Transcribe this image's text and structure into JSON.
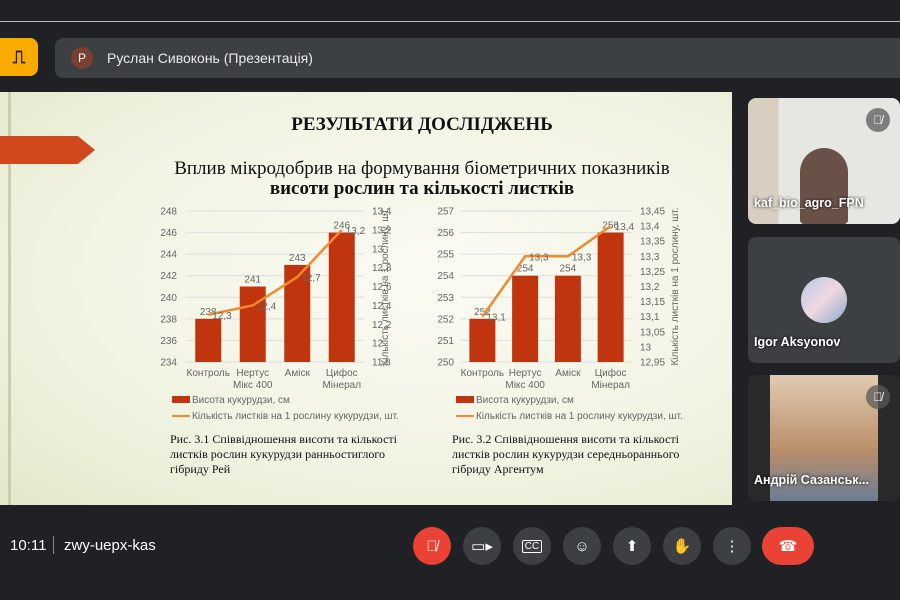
{
  "meeting": {
    "time": "10:11",
    "code": "zwy-uepx-kas"
  },
  "presenter": {
    "avatar_letter": "Р",
    "label": "Руслан Сивоконь (Презентація)"
  },
  "slide": {
    "title": "РЕЗУЛЬТАТИ ДОСЛІДЖЕНЬ",
    "subtitle_line1": "Вплив мікродобрив на формування біометричних показників",
    "subtitle_line2": "висоти рослин та кількості листків",
    "captions": [
      "Рис. 3.1 Співвідношення висоти та кількості листків рослин кукурудзи ранньостиглого гібриду Рей",
      "Рис. 3.2 Співвідношення висоти та кількості листків рослин кукурудзи середньораннього гібриду Аргентум"
    ]
  },
  "chart_data": [
    {
      "type": "bar+line",
      "categories": [
        "Контроль",
        "Нертус Мікс 400",
        "Аміск",
        "Цифос Мінерал"
      ],
      "series": [
        {
          "name": "Висота кукурудзи, см",
          "type": "bar",
          "axis": "left",
          "values": [
            238,
            241,
            243,
            246
          ],
          "color": "#c0340e"
        },
        {
          "name": "Кількість листків на 1 рослину кукурудзи, шт.",
          "type": "line",
          "axis": "right",
          "values": [
            12.3,
            12.4,
            12.7,
            13.2
          ],
          "color": "#f4892c"
        }
      ],
      "ylim": [
        234,
        248
      ],
      "yticks": [
        "234",
        "236",
        "238",
        "240",
        "242",
        "244",
        "246",
        "248"
      ],
      "y2lim": [
        11.8,
        13.4
      ],
      "y2ticks": [
        "11,8",
        "12",
        "12,2",
        "12,4",
        "12,6",
        "12,8",
        "13",
        "13,2",
        "13,4"
      ],
      "y2label": "Кількість листків на 1 рослину, шт.",
      "bar_labels": [
        "238",
        "241",
        "243",
        "246"
      ],
      "line_labels": [
        "12,3",
        "12,4",
        "12,7",
        "13,2"
      ]
    },
    {
      "type": "bar+line",
      "categories": [
        "Контроль",
        "Нертус Мікс 400",
        "Аміск",
        "Цифос Мінерал"
      ],
      "series": [
        {
          "name": "Висота кукурудзи, см",
          "type": "bar",
          "axis": "left",
          "values": [
            252,
            254,
            254,
            256
          ],
          "color": "#c0340e"
        },
        {
          "name": "Кількість листків на 1 рослину кукурудзи, шт.",
          "type": "line",
          "axis": "right",
          "values": [
            13.1,
            13.3,
            13.3,
            13.4
          ],
          "color": "#f4892c"
        }
      ],
      "ylim": [
        250,
        257
      ],
      "yticks": [
        "250",
        "251",
        "252",
        "253",
        "254",
        "255",
        "256",
        "257"
      ],
      "y2lim": [
        12.95,
        13.45
      ],
      "y2ticks": [
        "12,95",
        "13",
        "13,05",
        "13,1",
        "13,15",
        "13,2",
        "13,25",
        "13,3",
        "13,35",
        "13,4",
        "13,45"
      ],
      "y2label": "Кількість листків на 1 рослину, шт.",
      "bar_labels": [
        "252",
        "254",
        "254",
        "256"
      ],
      "line_labels": [
        "13,1",
        "13,3",
        "13,3",
        "13,4"
      ]
    }
  ],
  "participants": [
    {
      "name": "kaf_bio_agro_FPN",
      "muted": true
    },
    {
      "name": "Igor Aksyonov",
      "muted": false
    },
    {
      "name": "Андрій Сазанськ...",
      "muted": true
    }
  ],
  "controls": [
    {
      "name": "microphone-off",
      "color": "#ea4335"
    },
    {
      "name": "camera"
    },
    {
      "name": "captions"
    },
    {
      "name": "emoji"
    },
    {
      "name": "present"
    },
    {
      "name": "raise-hand"
    },
    {
      "name": "more-options"
    },
    {
      "name": "leave-call",
      "color": "#ea4335"
    }
  ]
}
